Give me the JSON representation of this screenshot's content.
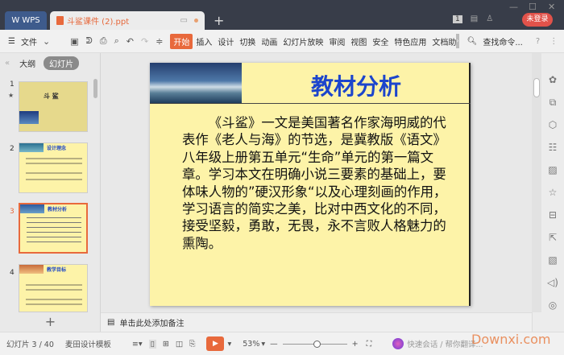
{
  "titlebar": {
    "app_tab": "WPS",
    "doc_tab": "斗鲨课件 (2).ppt",
    "new_tab": "+",
    "badge": "1",
    "login": "未登录",
    "min": "—",
    "max": "☐",
    "close": "✕"
  },
  "toolbar": {
    "file": "文件",
    "tabs": [
      "开始",
      "插入",
      "设计",
      "切换",
      "动画",
      "幻灯片放映",
      "审阅",
      "视图",
      "安全",
      "特色应用",
      "文档助"
    ],
    "search": "查找命令...",
    "help": "?",
    "more": "⋮",
    "collapse": "∨"
  },
  "left_panel": {
    "outline": "大纲",
    "slides": "幻灯片",
    "thumbs": [
      {
        "num": "1",
        "title": "斗 鲨"
      },
      {
        "num": "2",
        "title": "设计理念"
      },
      {
        "num": "3",
        "title": "教材分析"
      },
      {
        "num": "4",
        "title": "教学目标"
      }
    ],
    "add": "+"
  },
  "slide": {
    "title": "教材分析",
    "body": "《斗鲨》一文是美国著名作家海明威的代表作《老人与海》的节选，是冀教版《语文》八年级上册第五单元“生命”单元的第一篇文章。学习本文在明确小说三要素的基础上，要体味人物的”硬汉形象“以及心理刻画的作用，学习语言的简实之美，比对中西文化的不同，接受坚毅，勇敢，无畏，永不言败人格魅力的熏陶。"
  },
  "notes": {
    "placeholder": "单击此处添加备注"
  },
  "status": {
    "slide_counter": "幻灯片 3 / 40",
    "template": "麦田设计模板",
    "zoom": "53%",
    "minus": "—",
    "plus": "+",
    "assistant": "快速会话 / 帮你翻译..."
  },
  "colors": {
    "accent": "#e8693c",
    "title_blue": "#1c45cc",
    "slide_bg": "#fdf3a8",
    "titlebar": "#383d49"
  }
}
